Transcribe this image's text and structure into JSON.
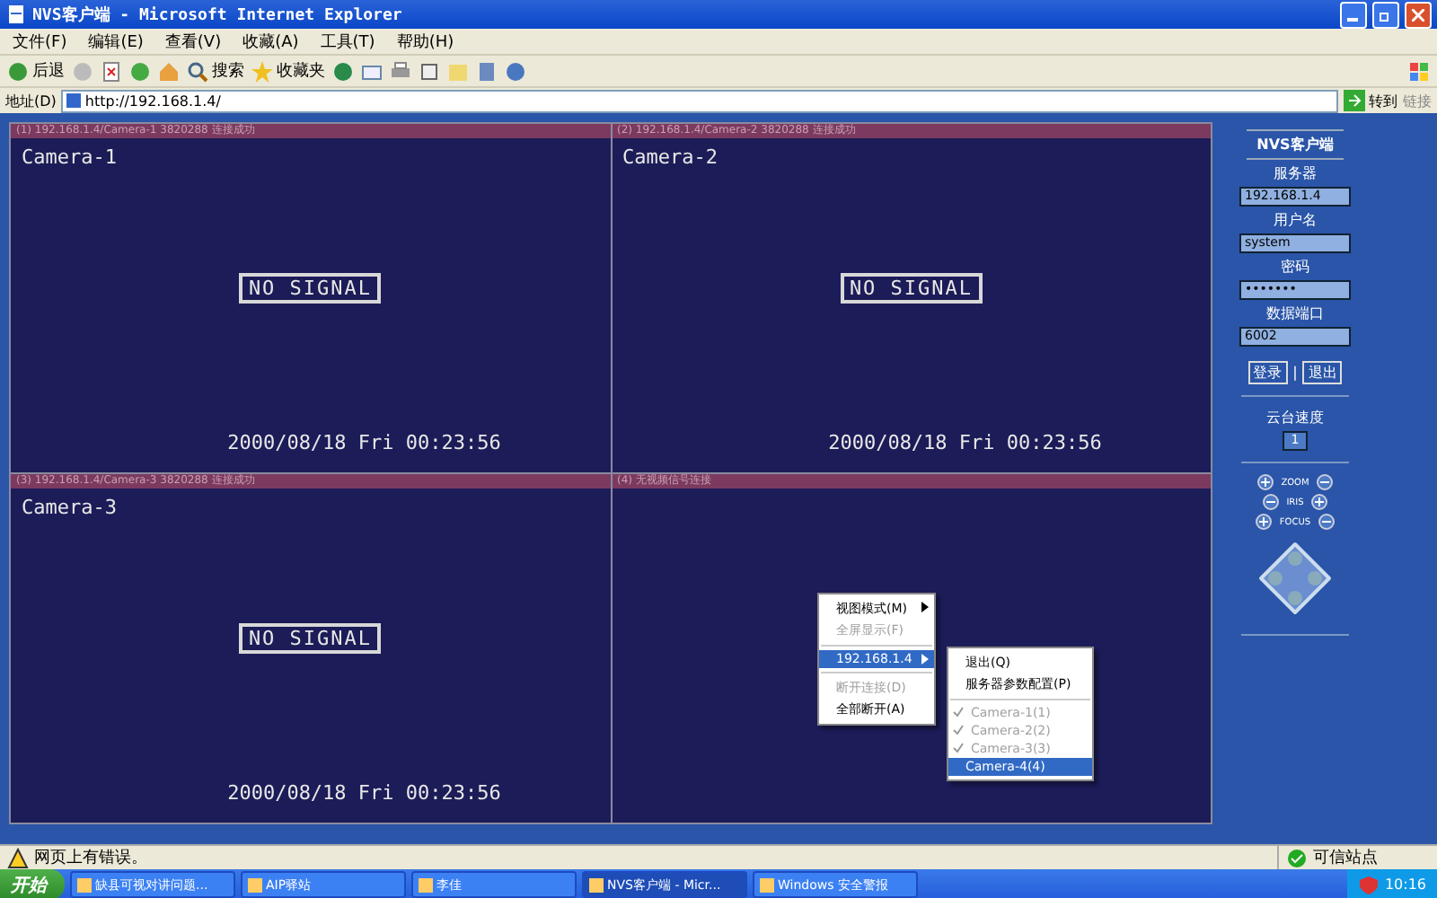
{
  "window": {
    "title": "NVS客户端 - Microsoft Internet Explorer"
  },
  "menu": [
    "文件(F)",
    "编辑(E)",
    "查看(V)",
    "收藏(A)",
    "工具(T)",
    "帮助(H)"
  ],
  "toolbar": {
    "back": "后退",
    "search": "搜索",
    "favorites": "收藏夹"
  },
  "address": {
    "label": "地址(D)",
    "value": "http://192.168.1.4/",
    "go": "转到",
    "links": "链接"
  },
  "panes": [
    {
      "header": "(1) 192.168.1.4/Camera-1 3820288 连接成功",
      "camera": "Camera-1",
      "signal": "NO SIGNAL",
      "timestamp": "2000/08/18 Fri 00:23:56"
    },
    {
      "header": "(2) 192.168.1.4/Camera-2 3820288 连接成功",
      "camera": "Camera-2",
      "signal": "NO SIGNAL",
      "timestamp": "2000/08/18 Fri 00:23:56"
    },
    {
      "header": "(3) 192.168.1.4/Camera-3 3820288 连接成功",
      "camera": "Camera-3",
      "signal": "NO SIGNAL",
      "timestamp": "2000/08/18 Fri 00:23:56"
    },
    {
      "header": "(4) 无视频信号连接"
    }
  ],
  "context_menu": {
    "items": [
      {
        "label": "视图模式(M)",
        "disabled": false,
        "arrow": true,
        "selected": false
      },
      {
        "label": "全屏显示(F)",
        "disabled": true,
        "arrow": false,
        "selected": false
      },
      {
        "label": "192.168.1.4",
        "disabled": false,
        "arrow": true,
        "selected": true
      },
      {
        "label": "断开连接(D)",
        "disabled": true,
        "arrow": false,
        "selected": false
      },
      {
        "label": "全部断开(A)",
        "disabled": false,
        "arrow": false,
        "selected": false
      }
    ],
    "submenu": [
      {
        "label": "退出(Q)",
        "checked": false,
        "disabled": false,
        "selected": false
      },
      {
        "label": "服务器参数配置(P)",
        "checked": false,
        "disabled": false,
        "selected": false
      },
      {
        "label": "Camera-1(1)",
        "checked": true,
        "disabled": true,
        "selected": false
      },
      {
        "label": "Camera-2(2)",
        "checked": true,
        "disabled": true,
        "selected": false
      },
      {
        "label": "Camera-3(3)",
        "checked": true,
        "disabled": true,
        "selected": false
      },
      {
        "label": "Camera-4(4)",
        "checked": false,
        "disabled": false,
        "selected": true
      }
    ]
  },
  "panel": {
    "title": "NVS客户端",
    "fields": [
      {
        "label": "服务器",
        "value": "192.168.1.4"
      },
      {
        "label": "用户名",
        "value": "system"
      },
      {
        "label": "密码",
        "value": "•••••••"
      },
      {
        "label": "数据端口",
        "value": "6002"
      }
    ],
    "buttons": [
      "登录",
      "退出"
    ],
    "separator": "|",
    "speed": {
      "label": "云台速度",
      "value": "1"
    },
    "lens": [
      "ZOOM",
      "IRIS",
      "FOCUS"
    ]
  },
  "status": {
    "message": "网页上有错误。",
    "zone": "可信站点"
  },
  "taskbar": {
    "start": "开始",
    "tasks": [
      {
        "label": "缺县可视对讲问题...",
        "selected": false
      },
      {
        "label": "AIP驿站",
        "selected": false
      },
      {
        "label": "李佳",
        "selected": false
      },
      {
        "label": "NVS客户端 - Micr...",
        "selected": true
      },
      {
        "label": "Windows 安全警报",
        "selected": false
      }
    ],
    "clock": "10:16"
  }
}
